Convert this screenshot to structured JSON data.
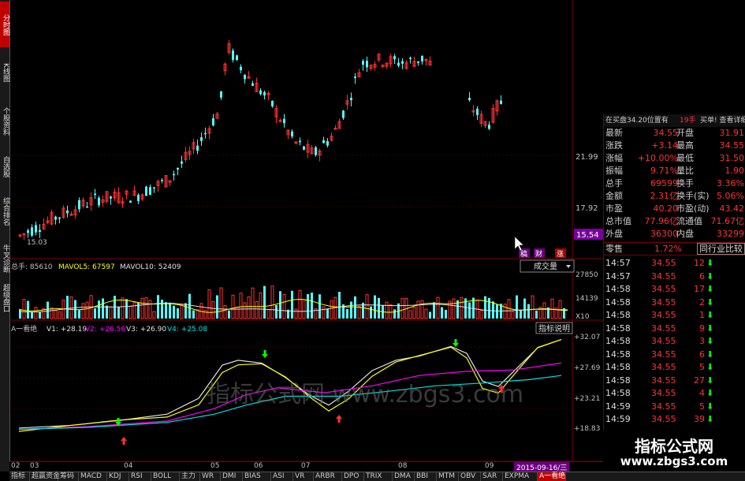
{
  "left_tabs": [
    "分时图",
    "K线图",
    "个股资料",
    "自选股",
    "综合排名",
    "牛叉诊断",
    "超级盘口"
  ],
  "price_panel": {
    "y_labels": [
      "21.99",
      "17.92"
    ],
    "current_price_badge": "15.54",
    "low_marker": "15.03",
    "badges": [
      "稿",
      "财",
      "涨"
    ]
  },
  "volume_panel": {
    "header_total": "总手: 85610",
    "mavol5": "MAVOL5: 67597",
    "mavol10": "MAVOL10: 52409",
    "y_labels": [
      "27850",
      "14139",
      "X10"
    ],
    "indicator_select": "成交量"
  },
  "indicator_panel": {
    "header_name": "A一看绝",
    "v1": "V1: +28.19",
    "v2": "V2: +26.56",
    "v3": "V3: +26.90",
    "v4": "V4: +25.08",
    "y_labels": [
      "+32.07",
      "+27.69",
      "+23.21",
      "+18.83"
    ],
    "help_button": "指标说明",
    "watermark_text": "指标公式网 www.zbgs3.com"
  },
  "x_axis": {
    "labels": [
      "02",
      "03",
      "04",
      "05",
      "06",
      "07",
      "08",
      "09"
    ],
    "date_badge": "2015-09-16/三"
  },
  "right_panel": {
    "header_left": "在买盘34.20位置有",
    "header_mid": "19手",
    "header_right": "买单! 查看详细",
    "quote_rows": [
      {
        "l1": "最新",
        "v1": "34.55",
        "l2": "开盘",
        "v2": "31.91"
      },
      {
        "l1": "涨跌",
        "v1": "+3.14",
        "l2": "最高",
        "v2": "34.55"
      },
      {
        "l1": "涨幅",
        "v1": "+10.00%",
        "l2": "最低",
        "v2": "31.50"
      },
      {
        "l1": "振幅",
        "v1": "9.71%",
        "l2": "量比",
        "v2": "1.90"
      },
      {
        "l1": "总手",
        "v1": "69599",
        "l2": "换手",
        "v2": "3.36%"
      },
      {
        "l1": "金额",
        "v1": "2.31亿",
        "l2": "换手(实)",
        "v2": "5.06%"
      },
      {
        "l1": "市盈",
        "v1": "40.20",
        "l2": "市盈(动)",
        "v2": "43.42"
      },
      {
        "l1": "总市值",
        "v1": "77.96亿",
        "l2": "流通值",
        "v2": "71.67亿"
      },
      {
        "l1": "外盘",
        "v1": "36300",
        "l2": "内盘",
        "v2": "33299"
      }
    ],
    "industry_label": "零售",
    "industry_change": "1.72%",
    "industry_compare_button": "同行业比较",
    "ticks": [
      {
        "time": "14:57",
        "price": "34.55",
        "vol": "12"
      },
      {
        "time": "14:57",
        "price": "34.55",
        "vol": "6"
      },
      {
        "time": "14:58",
        "price": "34.55",
        "vol": "17"
      },
      {
        "time": "14:58",
        "price": "34.55",
        "vol": "2"
      },
      {
        "time": "14:58",
        "price": "34.55",
        "vol": "1"
      },
      {
        "time": "14:58",
        "price": "34.55",
        "vol": "9"
      },
      {
        "time": "14:58",
        "price": "34.55",
        "vol": "3"
      },
      {
        "time": "14:58",
        "price": "34.55",
        "vol": "6"
      },
      {
        "time": "14:58",
        "price": "34.55",
        "vol": "5"
      },
      {
        "time": "14:58",
        "price": "34.55",
        "vol": "27"
      },
      {
        "time": "14:58",
        "price": "34.55",
        "vol": "4"
      },
      {
        "time": "14:59",
        "price": "34.55",
        "vol": "5"
      },
      {
        "time": "14:59",
        "price": "34.55",
        "vol": "39"
      }
    ]
  },
  "bottom_tabs": [
    "指标",
    "超赢资金",
    "筹码",
    "MACD",
    "KDJ",
    "RSI",
    "BOLL",
    "主力",
    "WR",
    "DMI",
    "BIAS",
    "ASI",
    "VR",
    "ARBR",
    "DPO",
    "TRIX",
    "DMA",
    "BBI",
    "MTM",
    "OBV",
    "SAR",
    "EXPMA",
    "A一看绝"
  ],
  "site_watermark": {
    "title": "指标公式网",
    "url": "www.zbgs3.com"
  },
  "colors": {
    "up": "#ff3232",
    "down": "#54fcfc",
    "grid": "#7a0000",
    "ma_white": "#e0e0e0",
    "ma_yellow": "#ffff00",
    "ma_purple": "#ff00ff",
    "ma_cyan": "#00e0e0"
  },
  "chart_data": {
    "type": "candlestick",
    "series_note": "",
    "candles_close_trend": [
      15.03,
      16.2,
      17.1,
      17.5,
      17.0,
      17.8,
      18.5,
      19.9,
      21.5,
      23.5,
      27.0,
      25.5,
      24.0,
      21.0,
      19.5,
      20.5,
      23.5,
      26.5,
      27.0,
      26.0,
      24.5,
      22.0,
      23.5,
      24.5
    ],
    "indicator_lines": [
      "V1",
      "V2",
      "V3",
      "V4"
    ]
  }
}
